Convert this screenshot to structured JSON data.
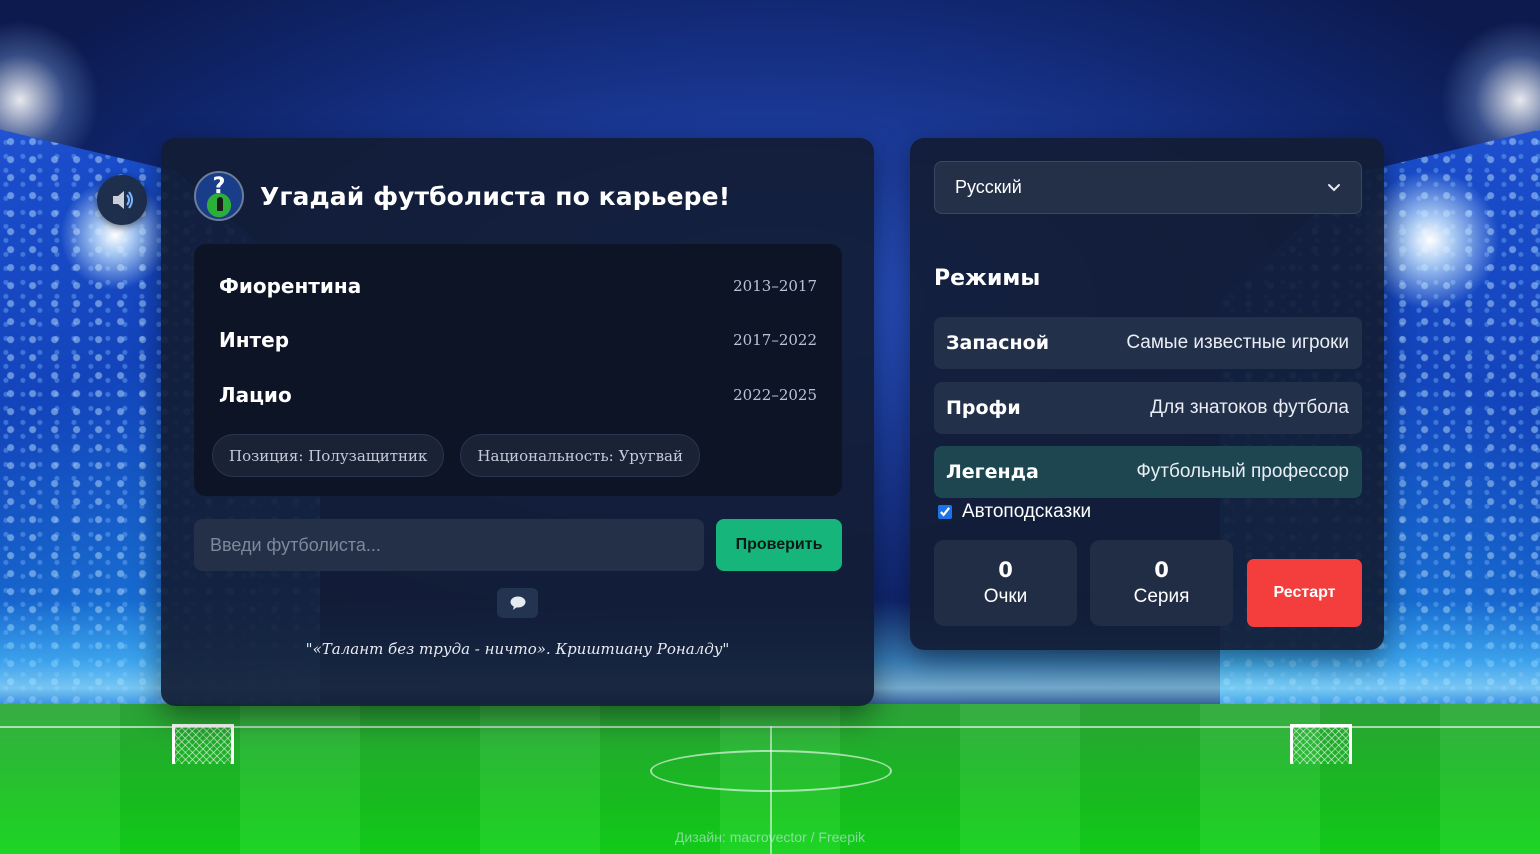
{
  "game": {
    "title": "Угадай футболиста по карьере!",
    "career": [
      {
        "club": "Фиорентина",
        "years": "2013–2017"
      },
      {
        "club": "Интер",
        "years": "2017–2022"
      },
      {
        "club": "Лацио",
        "years": "2022–2025"
      }
    ],
    "hints": {
      "position": "Позиция: Полузащитник",
      "nationality": "Национальность: Уругвай"
    },
    "input_placeholder": "Введи футболиста...",
    "check_label": "Проверить",
    "quote": "\"«Талант без труда - ничто». Криштиану Роналду\""
  },
  "settings": {
    "language": "Русский",
    "modes_title": "Режимы",
    "modes": [
      {
        "name": "Запасной",
        "desc": "Самые известные игроки",
        "active": false
      },
      {
        "name": "Профи",
        "desc": "Для знатоков футбола",
        "active": false
      },
      {
        "name": "Легенда",
        "desc": "Футбольный профессор",
        "active": true
      }
    ],
    "autohints_label": "Автоподсказки",
    "autohints_checked": true
  },
  "stats": {
    "score_value": "0",
    "score_label": "Очки",
    "streak_value": "0",
    "streak_label": "Серия"
  },
  "restart_label": "Рестарт",
  "credit": "Дизайн: macrovector / Freepik",
  "icons": {
    "sound": "speaker-icon",
    "logo": "question-player-icon",
    "hint": "speech-bubble-icon",
    "dropdown": "chevron-down-icon"
  },
  "colors": {
    "check_button": "#16b57c",
    "restart_button": "#f43e3e",
    "panel": "#121c34",
    "active_mode": "#1e4650"
  }
}
